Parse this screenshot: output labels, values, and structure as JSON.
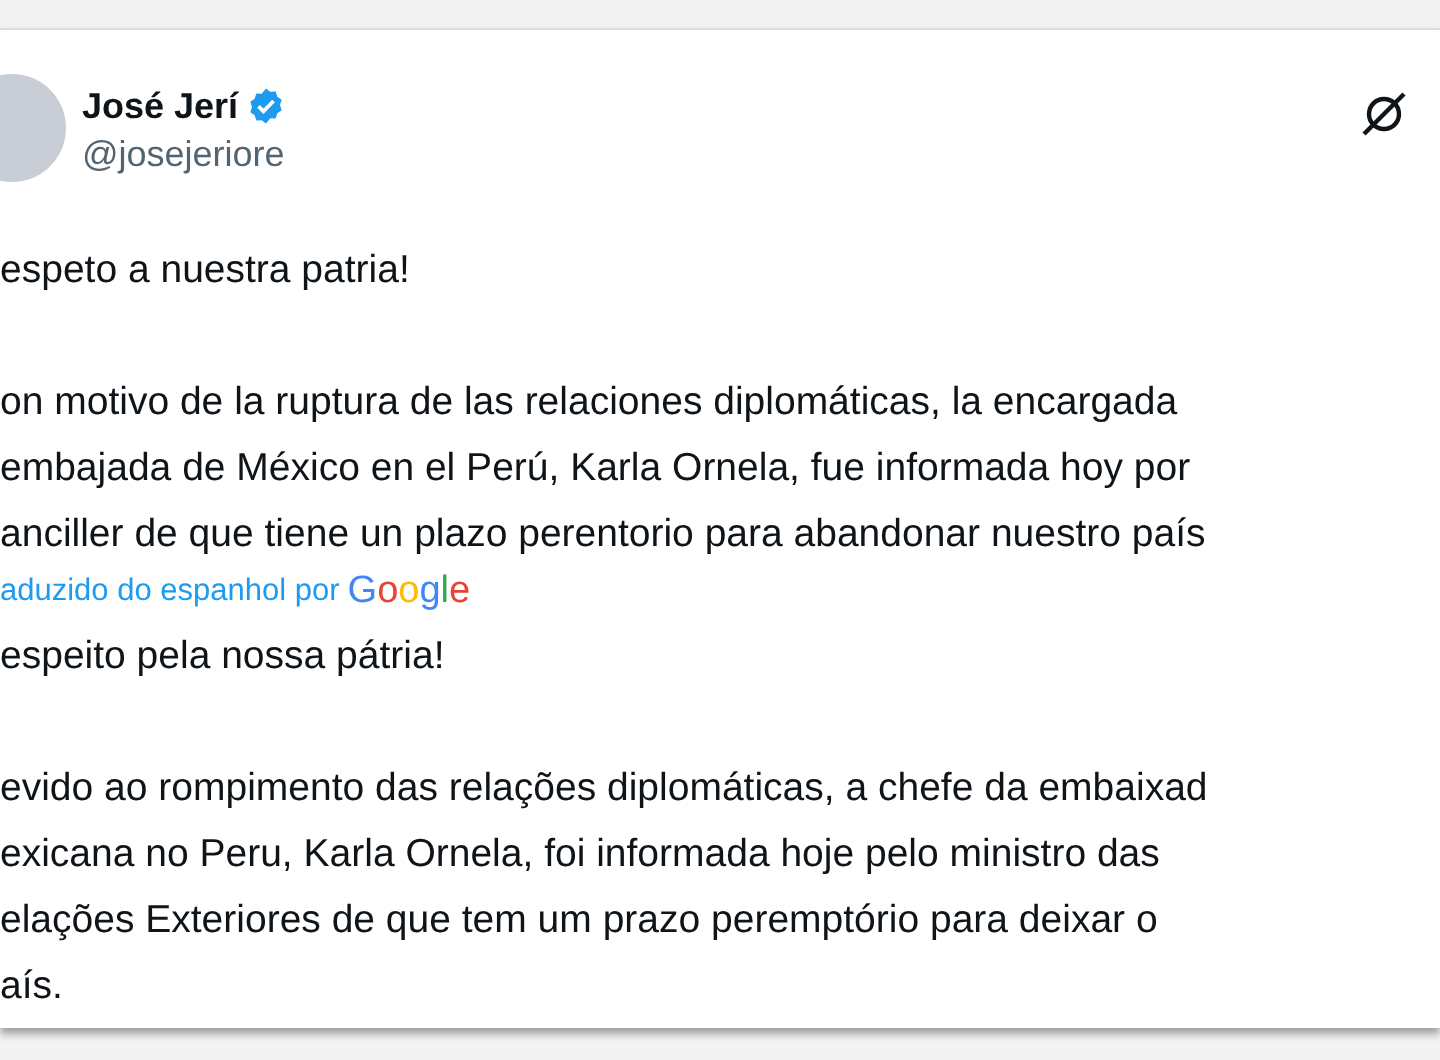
{
  "author": {
    "name": "José Jerí",
    "verified": true,
    "handle": "@josejeriore"
  },
  "original_paragraphs": [
    [
      "espeto a nuestra patria!"
    ],
    [
      "on motivo de la ruptura de las relaciones diplomáticas, la encargada",
      "embajada de México en el Perú, Karla Ornela, fue informada hoy por",
      "anciller de que tiene un plazo perentorio para abandonar nuestro país"
    ]
  ],
  "translation_note": {
    "text": "aduzido do espanhol por",
    "provider": "Google"
  },
  "translated_paragraphs": [
    [
      "espeito pela nossa pátria!"
    ],
    [
      "evido ao rompimento das relações diplomáticas, a chefe da embaixad",
      "exicana no Peru, Karla Ornela, foi informada hoje pelo ministro das",
      "elações Exteriores de que tem um prazo peremptório para deixar o",
      "aís."
    ]
  ]
}
